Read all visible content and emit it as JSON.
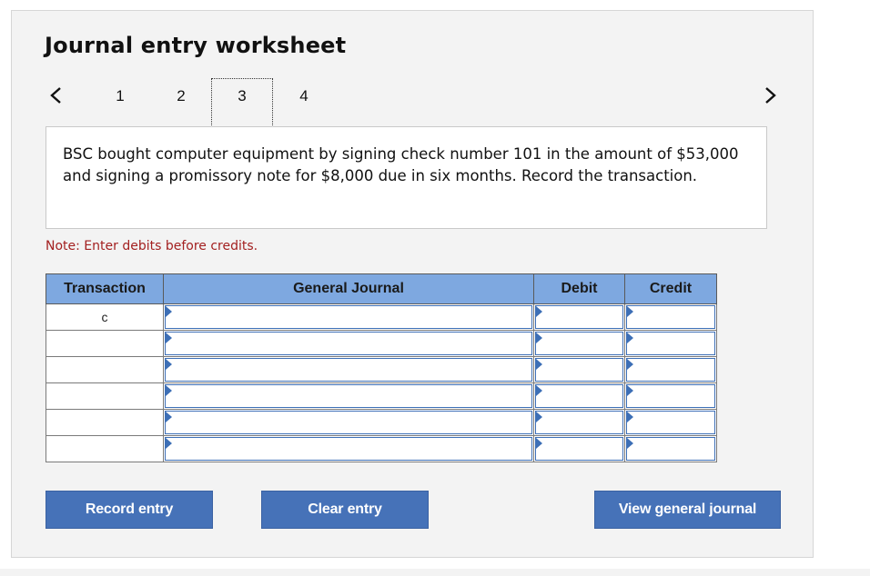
{
  "worksheet": {
    "title": "Journal entry worksheet",
    "steps": [
      "1",
      "2",
      "3",
      "4"
    ],
    "active_step": "3"
  },
  "question": {
    "text": "BSC bought computer equipment by signing check number 101 in the amount of $53,000 and signing a promissory note for $8,000 due in six months. Record the transaction."
  },
  "note": "Note: Enter debits before credits.",
  "table": {
    "headers": {
      "transaction": "Transaction",
      "general_journal": "General Journal",
      "debit": "Debit",
      "credit": "Credit"
    },
    "rows": [
      {
        "transaction": "c"
      },
      {
        "transaction": ""
      },
      {
        "transaction": ""
      },
      {
        "transaction": ""
      },
      {
        "transaction": ""
      },
      {
        "transaction": ""
      }
    ]
  },
  "buttons": {
    "record": "Record entry",
    "clear": "Clear entry",
    "view": "View general journal"
  },
  "icons": {
    "prev": "chevron-left-icon",
    "next": "chevron-right-icon",
    "field_marker": "triangle-right-icon"
  },
  "colors": {
    "header_bg": "#7ea8e0",
    "button_bg": "#4672b8",
    "note": "#a32020",
    "field_border": "#3d6fb6"
  }
}
